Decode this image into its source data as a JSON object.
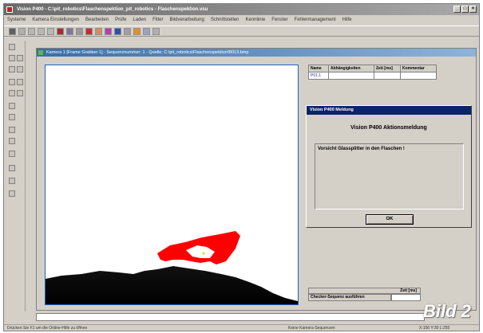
{
  "window": {
    "title": "Vision P400 - C:\\pit_robotics\\Flaschenspektion_pit_robotics - Flaschenspektion.vsu",
    "minimize_label": "_",
    "maximize_label": "□",
    "close_label": "×"
  },
  "menubar": {
    "items": [
      "Systeme",
      "Kamera Einstellungen",
      "Bearbeiten",
      "Prüfe",
      "Laden",
      "Filter",
      "Bildverarbeitung",
      "Schnittstellen",
      "Kennlinie",
      "Fenster",
      "Fehlermanagement",
      "Hilfe"
    ]
  },
  "camera_window": {
    "title": "Kamera 1 [Frame Grabber 1] - Sequenznummer: 1 - Quelle: C:\\pit_robotics\\Flaschenspektion\\B013.bmp"
  },
  "results_table": {
    "headers": [
      "Name",
      "Abhängigkeiten",
      "Zeit [ms]",
      "Kommentar"
    ],
    "rows": [
      [
        "P01.1",
        "",
        "",
        ""
      ]
    ]
  },
  "dialog": {
    "title": "Vision P400 Meldung",
    "heading": "Vision P400 Aktionsmeldung",
    "message": "Vorsicht Glassplitter in den Flaschen !",
    "ok_label": "OK"
  },
  "sequence": {
    "time_header": "Zeit [ms]",
    "run_label": "Checker-Sequenz ausführen",
    "time_value": ""
  },
  "statusbar": {
    "left": "Drücken Sie F1 um die Online-Hilfe zu öffnen",
    "middle": "Keine Kamera-Sequenzen",
    "right": "X:156 Y:30 L:255"
  },
  "caption": "Bild 2",
  "colors": {
    "title_gradient_start": "#6b6b6b",
    "camera_title": "#3a6ea5",
    "dialog_title": "#0a246a",
    "defect_marker": "#ff0000",
    "image_border": "#2060c0"
  }
}
